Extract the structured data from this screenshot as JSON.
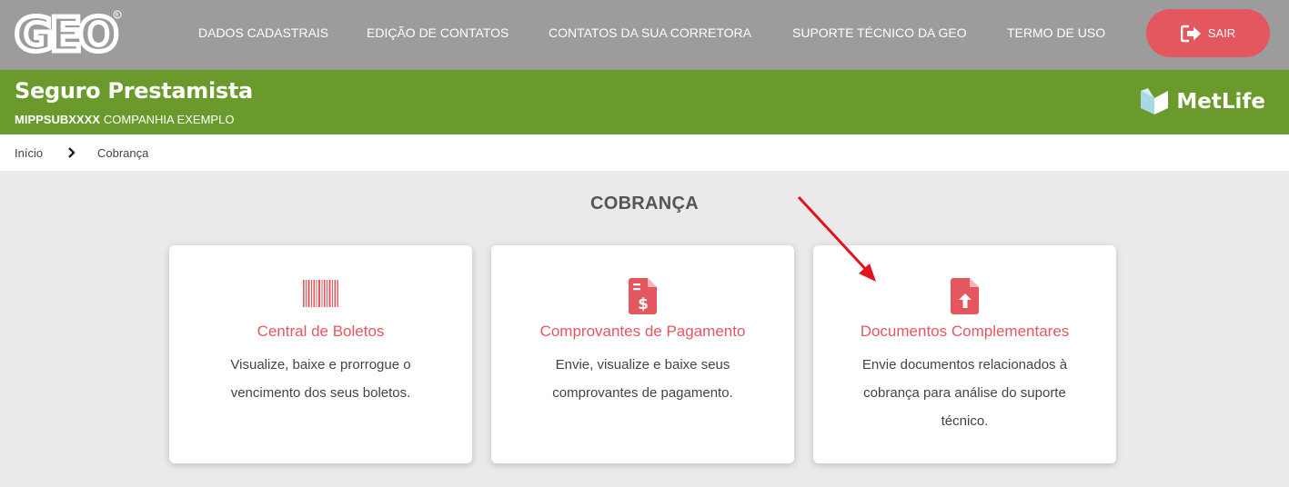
{
  "header": {
    "logo_text": "GEO",
    "nav": [
      {
        "label": "DADOS CADASTRAIS"
      },
      {
        "label": "EDIÇÃO DE CONTATOS"
      },
      {
        "label": "CONTATOS DA SUA CORRETORA"
      },
      {
        "label": "SUPORTE TÉCNICO DA GEO"
      },
      {
        "label": "TERMO DE USO"
      }
    ],
    "logout_label": "SAIR",
    "logout_icon": "sign-out-icon"
  },
  "product": {
    "title": "Seguro Prestamista",
    "code": "MIPPSUBXXXX",
    "company": "COMPANHIA EXEMPLO",
    "brand": "MetLife"
  },
  "breadcrumb": {
    "home": "Início",
    "separator": "›",
    "current": "Cobrança"
  },
  "page": {
    "title": "COBRANÇA"
  },
  "cards": [
    {
      "icon": "barcode-icon",
      "title": "Central de Boletos",
      "description": "Visualize, baixe e prorrogue o vencimento dos seus boletos."
    },
    {
      "icon": "payment-receipt-icon",
      "title": "Comprovantes de Pagamento",
      "description": "Envie, visualize e baixe seus comprovantes de pagamento."
    },
    {
      "icon": "document-upload-icon",
      "title": "Documentos Complementares",
      "description": "Envie documentos relacionados à cobrança para análise do suporte técnico."
    }
  ],
  "colors": {
    "topbar": "#9d9c9d",
    "greenbar": "#6a9a2c",
    "accent": "#e5575f",
    "annotation_arrow": "#e0141c"
  }
}
